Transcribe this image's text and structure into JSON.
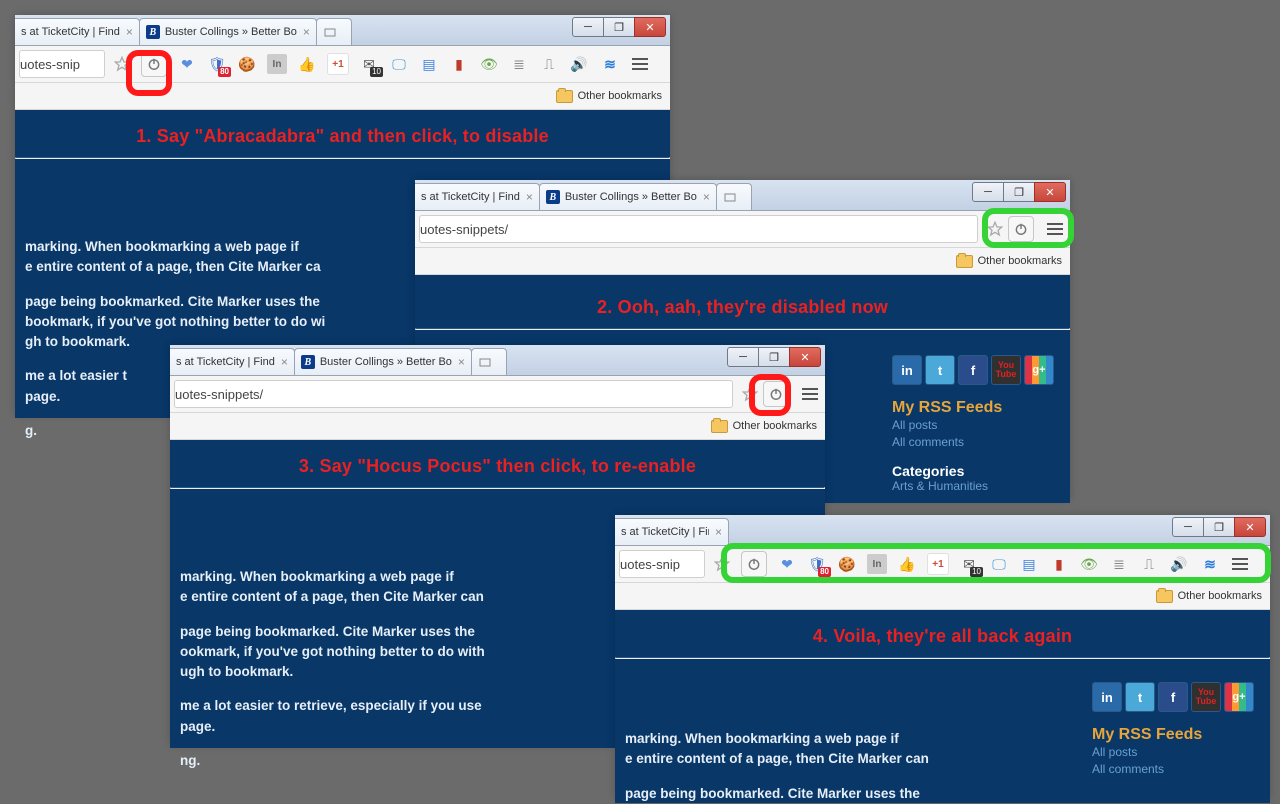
{
  "tabs": {
    "t1": "s at TicketCity | Find",
    "t2": "Buster Collings » Better Bo"
  },
  "url_frag_short": "uotes-snip",
  "url_frag_long": "uotes-snippets/",
  "other_bookmarks": "Other bookmarks",
  "captions": {
    "c1": "1. Say \"Abracadabra\" and then click, to disable",
    "c2": "2. Ooh, aah, they're disabled now",
    "c3": "3. Say \"Hocus Pocus\" then click, to re-enable",
    "c4": "4. Voila, they're all back again"
  },
  "page_text": {
    "p1a": "marking. When bookmarking a web page if",
    "p1b": "e entire content of a page, then Cite Marker ca",
    "p2a": "page being bookmarked. Cite Marker uses the",
    "p2b": "bookmark, if you've got nothing better to do wi",
    "p2c": "gh to bookmark.",
    "p3a": "me a lot easier t",
    "p3b": "page.",
    "p4": "g."
  },
  "page_text_wide": {
    "p1a": "marking. When bookmarking a web page if",
    "p1b": "e entire content of a page, then Cite Marker can",
    "p2a": "page being bookmarked. Cite Marker uses the",
    "p2b": "ookmark, if you've got nothing better to do with",
    "p2c": "ugh to bookmark.",
    "p3a": "me a lot easier to retrieve, especially if you use",
    "p3b": "page.",
    "p4": "ng."
  },
  "page_text_p4": {
    "p1a": "marking. When bookmarking a web page if",
    "p1b": "e entire content of a page, then Cite Marker can",
    "p2": "page being bookmarked. Cite Marker uses the"
  },
  "sidebar": {
    "rss_title": "My RSS Feeds",
    "all_posts": "All posts",
    "all_comments": "All comments",
    "categories": "Categories",
    "cat1": "Arts & Humanities"
  },
  "badges": {
    "shield": "80",
    "inbox": "10"
  },
  "icons": {
    "in_label": "In",
    "gplus_label": "+1",
    "waves": "≋",
    "b_fav": "B"
  }
}
